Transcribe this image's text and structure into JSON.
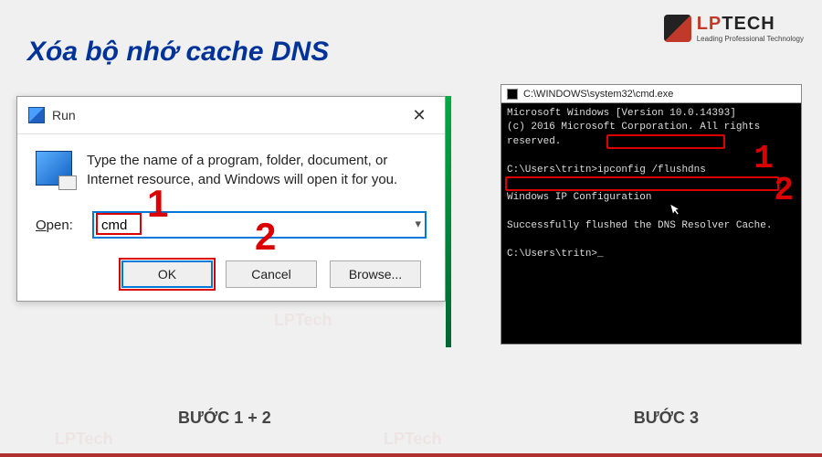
{
  "page": {
    "title": "Xóa bộ nhớ cache DNS",
    "step_left": "BƯỚC 1 + 2",
    "step_right": "BƯỚC 3"
  },
  "logo": {
    "text": "LPTECH",
    "sub": "Leading Professional Technology"
  },
  "run": {
    "title": "Run",
    "description": "Type the name of a program, folder, document, or Internet resource, and Windows will open it for you.",
    "open_label": "Open:",
    "open_value": "cmd",
    "ok": "OK",
    "cancel": "Cancel",
    "browse": "Browse..."
  },
  "annotations": {
    "run_num1": "1",
    "run_num2": "2",
    "cmd_num1": "1",
    "cmd_num2": "2"
  },
  "cmd": {
    "title_path": "C:\\WINDOWS\\system32\\cmd.exe",
    "line1": "Microsoft Windows [Version 10.0.14393]",
    "line2": "(c) 2016 Microsoft Corporation. All rights reserved.",
    "prompt1_prefix": "C:\\Users\\tritn>",
    "prompt1_cmd": "ipconfig /flushdns",
    "cfg": "Windows IP Configuration",
    "success": "Successfully flushed the DNS Resolver Cache.",
    "prompt2": "C:\\Users\\tritn>_"
  }
}
